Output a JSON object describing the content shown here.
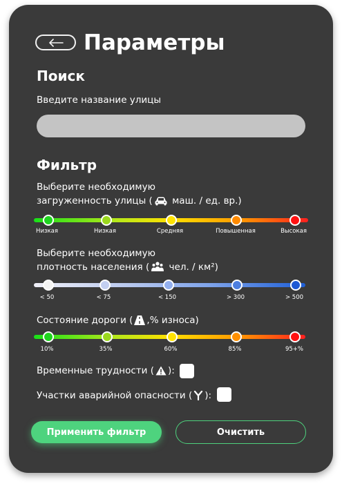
{
  "header": {
    "title": "Параметры",
    "back_icon": "arrow-left-icon"
  },
  "search": {
    "heading": "Поиск",
    "label": "Введите название улицы",
    "value": "",
    "placeholder": ""
  },
  "filter": {
    "heading": "Фильтр",
    "traffic": {
      "label_line1": "Выберите необходимую",
      "label_line2_prefix": "загруженность улицы (",
      "label_line2_suffix": " маш. / ед. вр.)",
      "icon": "car-icon",
      "ticks": [
        "Низкая",
        "Низкая",
        "Средняя",
        "Повышенная",
        "Высокая"
      ]
    },
    "density": {
      "label_line1": "Выберите необходимую",
      "label_line2_prefix": "плотность населения (",
      "label_line2_suffix": " чел. / км²)",
      "icon": "people-icon",
      "ticks": [
        "< 50",
        "< 75",
        "< 150",
        "> 300",
        "> 500"
      ]
    },
    "road": {
      "label_prefix": "Состояние дороги (",
      "label_suffix": ",% износа)",
      "icon": "road-icon",
      "ticks": [
        "10%",
        "35%",
        "60%",
        "85%",
        "95+%"
      ]
    },
    "temporary": {
      "label_prefix": "Временные трудности (",
      "label_suffix": "):",
      "icon": "warning-icon",
      "checked": false
    },
    "accident": {
      "label_prefix": "Участки аварийной опасности (",
      "label_suffix": "):",
      "icon": "fork-icon",
      "checked": false
    }
  },
  "actions": {
    "apply_label": "Применить фильтр",
    "clear_label": "Очистить"
  },
  "colors": {
    "accent": "#4ed37e",
    "panel": "#3a3a3a",
    "input": "#c4c4c4"
  }
}
